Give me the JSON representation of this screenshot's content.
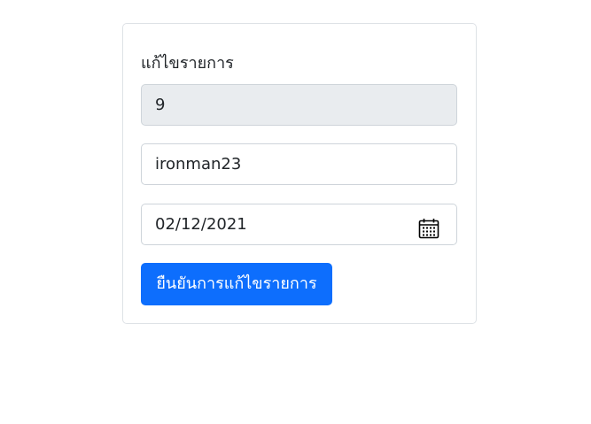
{
  "form": {
    "title": "แก้ไขรายการ",
    "id_value": "9",
    "username_value": "ironman23",
    "date_value": "02/12/2021",
    "submit_label": "ยืนยันการแก้ไขรายการ"
  },
  "icons": {
    "date_picker": "calendar-icon"
  },
  "colors": {
    "primary": "#0d6efd",
    "readonly_bg": "#e9ecef",
    "border": "#ced4da"
  }
}
